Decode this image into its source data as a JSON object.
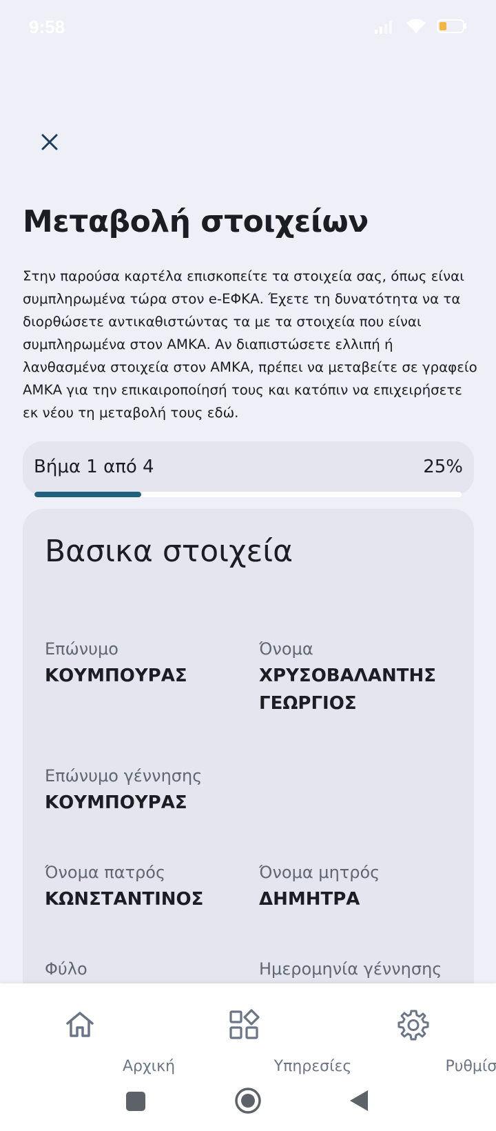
{
  "status_bar": {
    "time": "9:58"
  },
  "header": {
    "close_icon": "close-icon"
  },
  "page": {
    "title": "Μεταβολή στοιχείων",
    "intro": "Στην παρούσα καρτέλα επισκοπείτε τα στοιχεία σας, όπως είναι συμπληρωμένα τώρα στον e-ΕΦΚΑ. Έχετε τη δυνατότητα να τα διορθώσετε αντικαθιστώντας τα με τα στοιχεία που είναι συμπληρωμένα στον ΑΜΚΑ. Αν διαπιστώσετε ελλιπή ή λανθασμένα στοιχεία στον ΑΜΚΑ, πρέπει να μεταβείτε σε γραφείο ΑΜΚΑ για την επικαιροποίησή τους και κατόπιν να επιχειρήσετε εκ νέου τη μεταβολή τους εδώ."
  },
  "progress": {
    "step_label": "Βήμα 1 από 4",
    "percent_label": "25%",
    "fraction": 0.25,
    "color": "#22617e"
  },
  "card": {
    "title": "Βασικα στοιχεία",
    "fields": {
      "surname": {
        "label": "Επώνυμο",
        "value": "ΚΟΥΜΠΟΥΡΑΣ"
      },
      "name": {
        "label": "Όνομα",
        "value": "ΧΡΥΣΟΒΑΛΑΝΤΗΣ ΓΕΩΡΓΙΟΣ"
      },
      "birth_surname": {
        "label": "Επώνυμο γέννησης",
        "value": "ΚΟΥΜΠΟΥΡΑΣ"
      },
      "father_name": {
        "label": "Όνομα πατρός",
        "value": "ΚΩΝΣΤΑΝΤΙΝΟΣ"
      },
      "mother_name": {
        "label": "Όνομα μητρός",
        "value": "ΔΗΜΗΤΡΑ"
      },
      "gender": {
        "label": "Φύλο"
      },
      "birth_date": {
        "label": "Ημερομηνία γέννησης"
      }
    }
  },
  "bottom_nav": {
    "items": [
      {
        "label": "Αρχική",
        "icon": "home-icon"
      },
      {
        "label": "Υπηρεσίες",
        "icon": "services-icon"
      },
      {
        "label": "Ρυθμίσεις",
        "icon": "settings-icon"
      }
    ]
  },
  "system_nav": {
    "icons": [
      "recents-icon",
      "home-circle-icon",
      "back-icon"
    ]
  }
}
